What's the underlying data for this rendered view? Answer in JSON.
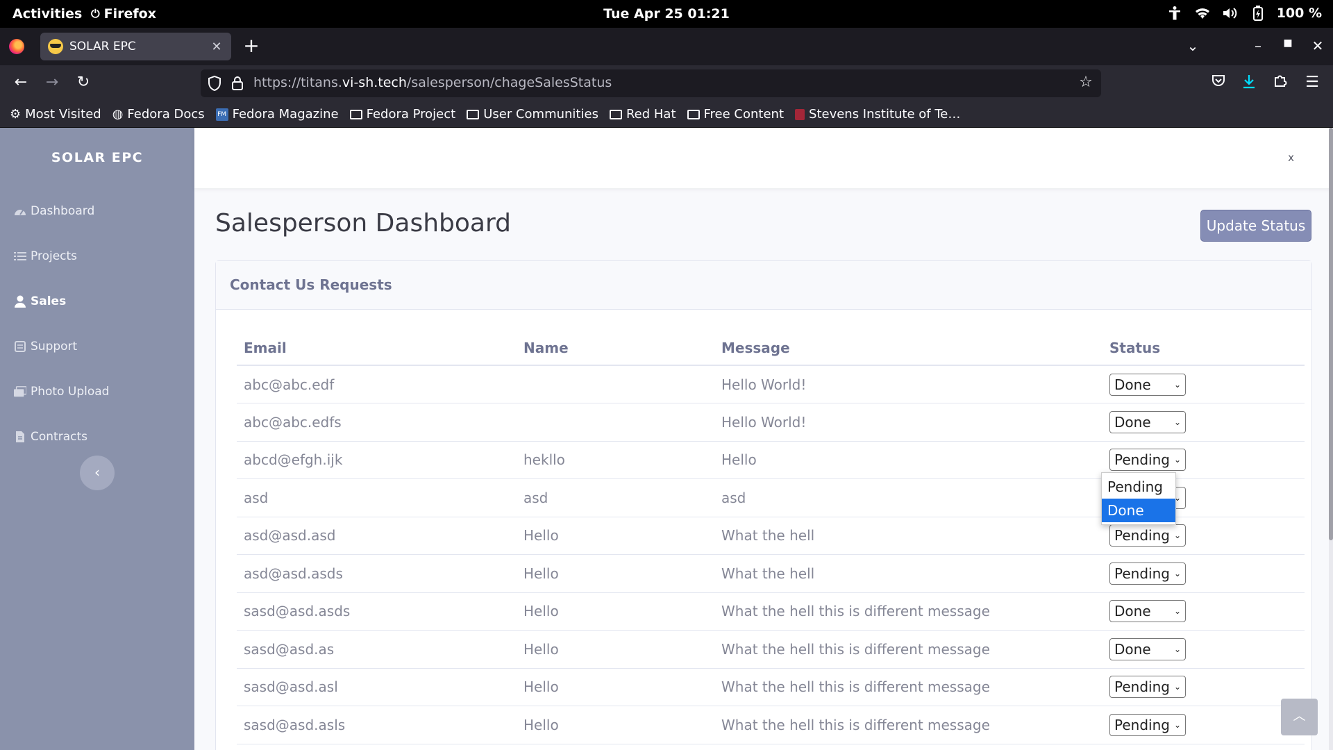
{
  "system": {
    "activities": "Activities",
    "app_name": "Firefox",
    "clock": "Tue Apr 25  01:21",
    "battery": "100 %"
  },
  "browser": {
    "tab_title": "SOLAR EPC",
    "url_prefix": "https://titans.",
    "url_domain": "vi-sh.tech",
    "url_path": "/salesperson/chageSalesStatus",
    "bookmarks": [
      "Most Visited",
      "Fedora Docs",
      "Fedora Magazine",
      "Fedora Project",
      "User Communities",
      "Red Hat",
      "Free Content",
      "Stevens Institute of Te…"
    ]
  },
  "sidebar": {
    "brand": "SOLAR EPC",
    "items": [
      {
        "label": "Dashboard"
      },
      {
        "label": "Projects"
      },
      {
        "label": "Sales"
      },
      {
        "label": "Support"
      },
      {
        "label": "Photo Upload"
      },
      {
        "label": "Contracts"
      }
    ],
    "active": "Sales"
  },
  "header": {
    "close_label": "x"
  },
  "main": {
    "title": "Salesperson Dashboard",
    "update_button": "Update Status",
    "card_title": "Contact Us Requests",
    "columns": [
      "Email",
      "Name",
      "Message",
      "Status"
    ],
    "rows": [
      {
        "email": "abc@abc.edf",
        "name": "",
        "message": "Hello World!",
        "status": "Done"
      },
      {
        "email": "abc@abc.edfs",
        "name": "",
        "message": "Hello World!",
        "status": "Done"
      },
      {
        "email": "abcd@efgh.ijk",
        "name": "hekllo",
        "message": "Hello",
        "status": "Pending"
      },
      {
        "email": "asd",
        "name": "asd",
        "message": "asd",
        "status": "Done"
      },
      {
        "email": "asd@asd.asd",
        "name": "Hello",
        "message": "What the hell",
        "status": "Pending"
      },
      {
        "email": "asd@asd.asds",
        "name": "Hello",
        "message": "What the hell",
        "status": "Pending"
      },
      {
        "email": "sasd@asd.asds",
        "name": "Hello",
        "message": "What the hell this is different message",
        "status": "Done"
      },
      {
        "email": "sasd@asd.as",
        "name": "Hello",
        "message": "What the hell this is different message",
        "status": "Done"
      },
      {
        "email": "sasd@asd.asl",
        "name": "Hello",
        "message": "What the hell this is different message",
        "status": "Pending"
      },
      {
        "email": "sasd@asd.asls",
        "name": "Hello",
        "message": "What the hell this is different message",
        "status": "Pending"
      }
    ],
    "open_dropdown": {
      "options": [
        "Pending",
        "Done"
      ],
      "highlighted": "Done"
    }
  },
  "colors": {
    "sidebar_bg": "#8a92ab",
    "button_bg": "#858db5",
    "highlight": "#1a73e8"
  }
}
